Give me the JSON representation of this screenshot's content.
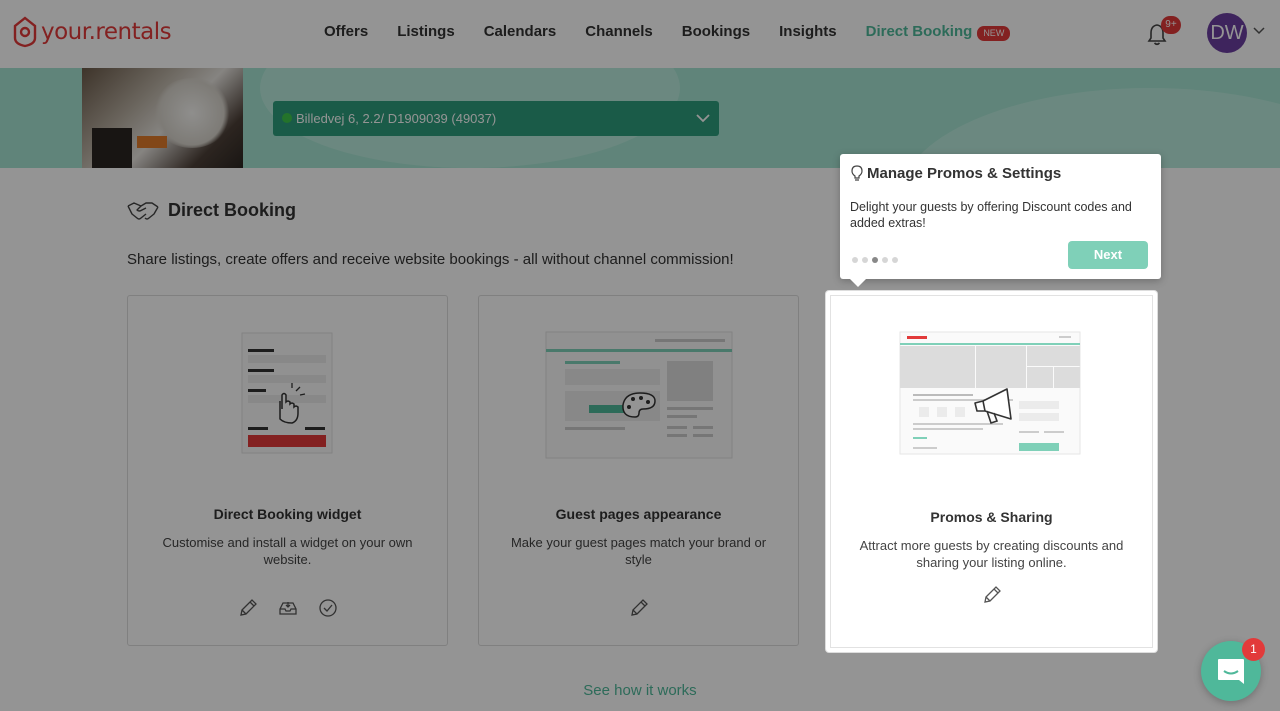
{
  "brand": {
    "name": "your.rentals",
    "color": "#e23a3a"
  },
  "nav": {
    "items": [
      {
        "label": "Offers"
      },
      {
        "label": "Listings"
      },
      {
        "label": "Calendars"
      },
      {
        "label": "Channels"
      },
      {
        "label": "Bookings"
      },
      {
        "label": "Insights"
      },
      {
        "label": "Direct Booking",
        "badge": "NEW"
      }
    ]
  },
  "header": {
    "notifications_count": "9+",
    "avatar_initials": "DW",
    "avatar_color": "#6b3fa0"
  },
  "listing_selector": {
    "value": "Billedvej 6, 2.2/ D1909039 (49037)"
  },
  "section": {
    "title": "Direct Booking",
    "description": "Share listings, create offers and receive website bookings - all without channel commission!"
  },
  "cards": [
    {
      "title": "Direct Booking widget",
      "description": "Customise and install a widget on your own website.",
      "actions": [
        "pencil-icon",
        "inbox-icon",
        "check-circle-icon"
      ]
    },
    {
      "title": "Guest pages appearance",
      "description": "Make your guest pages match your brand or style",
      "actions": [
        "pencil-icon"
      ]
    },
    {
      "title": "Promos & Sharing",
      "description": "Attract more guests by creating discounts and sharing your listing online.",
      "actions": [
        "pencil-icon"
      ]
    }
  ],
  "see_how_link": "See how it works",
  "tooltip": {
    "title": "Manage Promos & Settings",
    "body": "Delight your guests by offering Discount codes and added extras!",
    "next_label": "Next",
    "step_current": 3,
    "step_total": 5
  },
  "chat": {
    "unread": "1"
  },
  "colors": {
    "accent": "#4fb89a",
    "banner": "#a6e4d2",
    "select": "#2e9e7d"
  }
}
